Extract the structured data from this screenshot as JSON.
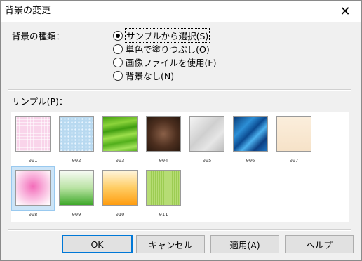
{
  "window": {
    "title": "背景の変更",
    "close_glyph": "✕"
  },
  "background_type": {
    "label": "背景の種類：",
    "options": [
      {
        "label": "サンプルから選択(S)",
        "selected": true
      },
      {
        "label": "単色で塗りつぶし(O)",
        "selected": false
      },
      {
        "label": "画像ファイルを使用(F)",
        "selected": false
      },
      {
        "label": "背景なし(N)",
        "selected": false
      }
    ]
  },
  "samples": {
    "label": "サンプル(P)：",
    "selected_index": 7,
    "items": [
      {
        "caption": "001",
        "pattern": "pink-check"
      },
      {
        "caption": "002",
        "pattern": "blue-dots"
      },
      {
        "caption": "003",
        "pattern": "green-waves"
      },
      {
        "caption": "004",
        "pattern": "brown-radial"
      },
      {
        "caption": "005",
        "pattern": "silver-gradient"
      },
      {
        "caption": "006",
        "pattern": "blue-streaks"
      },
      {
        "caption": "007",
        "pattern": "cream"
      },
      {
        "caption": "008",
        "pattern": "pink-radial"
      },
      {
        "caption": "009",
        "pattern": "green-gradient"
      },
      {
        "caption": "010",
        "pattern": "orange-gradient"
      },
      {
        "caption": "011",
        "pattern": "green-stripes"
      }
    ]
  },
  "buttons": {
    "ok": "OK",
    "cancel": "キャンセル",
    "apply": "適用(A)",
    "help": "ヘルプ"
  },
  "colors": {
    "dialog_bg": "#f0f0f0",
    "default_button_border": "#0078d7",
    "selection_bg": "#cce4f7"
  }
}
